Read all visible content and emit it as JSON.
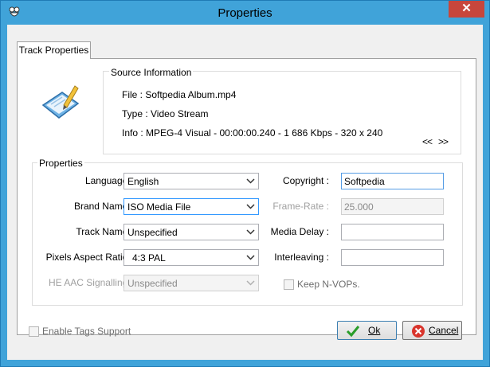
{
  "window": {
    "title": "Properties",
    "close_glyph": "✕"
  },
  "tabs": [
    {
      "label": "Track Properties"
    }
  ],
  "source": {
    "title": "Source Information",
    "file_line": "File : Softpedia Album.mp4",
    "type_line": "Type : Video Stream",
    "info_line": "Info : MPEG-4 Visual - 00:00:00.240 - 1 686 Kbps - 320 x 240",
    "prev_label": "<<",
    "next_label": ">>"
  },
  "properties": {
    "title": "Properties",
    "language": {
      "label": "Language :",
      "value": "English"
    },
    "brand_name": {
      "label": "Brand Name :",
      "value": "ISO Media File"
    },
    "track_name": {
      "label": "Track Name :",
      "value": "Unspecified"
    },
    "pixel_aspect": {
      "label": "Pixels Aspect Ratio :",
      "value": "4:3 PAL"
    },
    "he_aac": {
      "label": "HE AAC Signalling :",
      "value": "Unspecified"
    },
    "copyright": {
      "label": "Copyright :",
      "value": "Softpedia"
    },
    "frame_rate": {
      "label": "Frame-Rate :",
      "value": "25.000"
    },
    "media_delay": {
      "label": "Media Delay :",
      "value": ""
    },
    "interleaving": {
      "label": "Interleaving :",
      "value": ""
    },
    "keep_nvops": {
      "label": "Keep N-VOPs."
    }
  },
  "footer": {
    "enable_tags_label": "Enable Tags Support",
    "ok_label": "Ok",
    "cancel_label": "Cancel"
  },
  "icons": {
    "app": "app-logo-icon",
    "properties": "properties-edit-icon",
    "ok": "checkmark-icon",
    "cancel": "cancel-icon"
  },
  "colors": {
    "titlebar": "#40a3d9",
    "close": "#c7463c",
    "focus": "#3399ff"
  }
}
